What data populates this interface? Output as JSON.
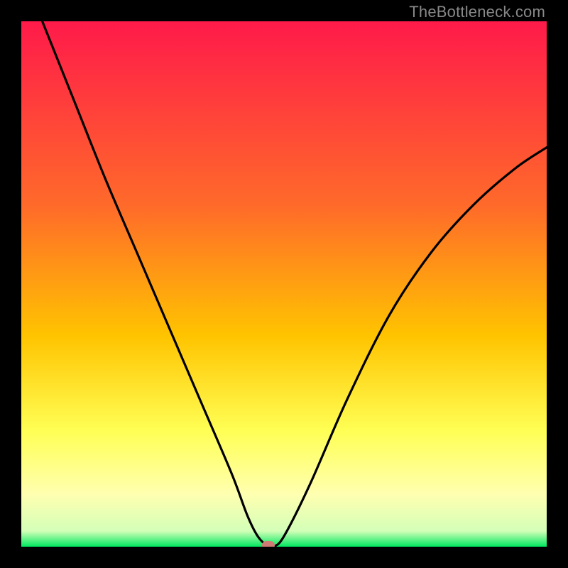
{
  "watermark": "TheBottleneck.com",
  "chart_data": {
    "type": "line",
    "title": "",
    "xlabel": "",
    "ylabel": "",
    "xlim": [
      0,
      100
    ],
    "ylim": [
      0,
      100
    ],
    "grid": false,
    "legend": false,
    "annotations": [],
    "series": [
      {
        "name": "bottleneck-curve",
        "x": [
          4,
          10,
          16,
          22,
          28,
          34,
          40,
          43,
          45,
          47,
          48,
          50,
          55,
          62,
          70,
          78,
          86,
          94,
          100
        ],
        "y": [
          100,
          85,
          70,
          56,
          42,
          28,
          14,
          6,
          2,
          0,
          0,
          2,
          12,
          28,
          44,
          56,
          65,
          72,
          76
        ]
      }
    ],
    "marker": {
      "x": 47,
      "y": 0
    },
    "gradient_stops": [
      {
        "offset": 0,
        "color": "#ff1a4a"
      },
      {
        "offset": 35,
        "color": "#ff6a2a"
      },
      {
        "offset": 60,
        "color": "#ffc400"
      },
      {
        "offset": 78,
        "color": "#ffff55"
      },
      {
        "offset": 90,
        "color": "#ffffb0"
      },
      {
        "offset": 97,
        "color": "#d4ffb8"
      },
      {
        "offset": 100,
        "color": "#00e85f"
      }
    ]
  }
}
